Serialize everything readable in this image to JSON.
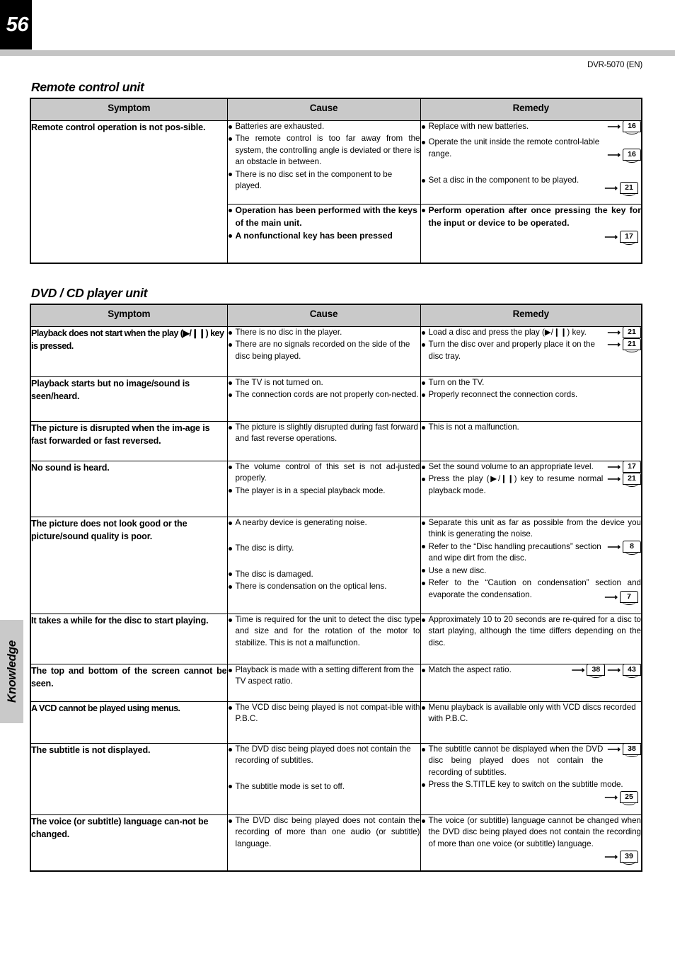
{
  "page": {
    "number": "56",
    "model_code": "DVR-5070 (EN)",
    "side_tab": "Knowledge"
  },
  "columns": [
    "Symptom",
    "Cause",
    "Remedy"
  ],
  "sections": [
    {
      "title": "Remote control unit",
      "rows": [
        {
          "symptom": "Remote control operation is not pos-sible.",
          "causes": [
            "Batteries are exhausted.",
            "The remote control is too far away from the system, the controlling angle is deviated or there is an obstacle in between.",
            "There is no disc set in the component to be played."
          ],
          "remedies": [
            "Replace with new batteries.",
            "Operate the unit inside the remote control-lable range.",
            "Set a disc in the component to be played."
          ],
          "refs": [
            "16",
            "16",
            "21"
          ]
        },
        {
          "symptom": "",
          "causes": [
            "Operation has been performed with the keys of the main unit.",
            "A nonfunctional key has been pressed"
          ],
          "remedies": [
            "Perform operation after once pressing the key for the input or device to be operated."
          ],
          "refs": [
            "17"
          ]
        }
      ]
    },
    {
      "title": "DVD / CD player unit",
      "rows": [
        {
          "symptom": "Playback does not start when the play (▶/❙❙) key is pressed.",
          "causes": [
            "There is no disc in the player.",
            "There are no signals recorded on the side of the disc being played."
          ],
          "remedies": [
            "Load a disc and press the play (▶/❙❙) key.",
            "Turn the disc over and properly place it on the disc tray."
          ],
          "refs": [
            "21",
            "21"
          ]
        },
        {
          "symptom": "Playback starts but no image/sound is seen/heard.",
          "causes": [
            "The TV is not turned on.",
            "The connection cords are not properly con-nected."
          ],
          "remedies": [
            "Turn on the TV.",
            "Properly reconnect the connection cords."
          ],
          "refs": []
        },
        {
          "symptom": "The picture is disrupted when the im-age is fast forwarded or fast reversed.",
          "causes": [
            "The picture is slightly disrupted during fast forward and fast reverse operations."
          ],
          "remedies": [
            "This is not a malfunction."
          ],
          "refs": []
        },
        {
          "symptom": "No sound is heard.",
          "causes": [
            "The volume control of this set is not ad-justed properly.",
            "The player is in a special playback mode."
          ],
          "remedies": [
            "Set the sound volume to an appropriate level.",
            "Press the play (▶/❙❙) key to resume normal playback mode."
          ],
          "refs": [
            "17",
            "21"
          ]
        },
        {
          "symptom": "The picture does not look good or the picture/sound quality is poor.",
          "causes": [
            "A nearby device is generating noise.",
            "The disc is dirty.",
            "The disc is damaged.",
            "There is condensation on the optical lens."
          ],
          "remedies": [
            "Separate this unit as far as possible from the device you think is generating the noise.",
            "Refer to the “Disc handling precautions” section and wipe dirt from the disc.",
            "Use a new disc.",
            "Refer to the “Caution on condensation” section and evaporate the condensation."
          ],
          "refs": [
            "8",
            "7"
          ]
        },
        {
          "symptom": "It takes a while for the disc to start playing.",
          "causes": [
            "Time is required for the unit to detect the disc type and size and for the rotation of the motor to stabilize. This is not a malfunction."
          ],
          "remedies": [
            "Approximately 10 to 20 seconds are re-quired for a disc to start playing, although the time differs depending on the disc."
          ],
          "refs": []
        },
        {
          "symptom": "The top and bottom of the screen cannot be seen.",
          "causes": [
            "Playback is made with a setting different from the TV aspect ratio."
          ],
          "remedies": [
            "Match the aspect ratio."
          ],
          "refs": [
            "38",
            "43"
          ]
        },
        {
          "symptom": "A VCD cannot be played using menus.",
          "causes": [
            "The VCD disc being played is not compat-ible with P.B.C."
          ],
          "remedies": [
            "Menu playback is available only with VCD discs recorded with P.B.C."
          ],
          "refs": []
        },
        {
          "symptom": "The subtitle is not displayed.",
          "causes": [
            "The DVD disc being played does not contain the recording of subtitles.",
            "The subtitle mode is set to off."
          ],
          "remedies": [
            "The subtitle cannot be displayed when the DVD disc being played does not contain the recording of subtitles.",
            "Press the S.TITLE key to switch on the subtitle mode."
          ],
          "refs": [
            "38",
            "25"
          ]
        },
        {
          "symptom": "The voice (or subtitle) language can-not be changed.",
          "causes": [
            "The DVD disc being played does not contain the recording of more than one audio (or subtitle) language."
          ],
          "remedies": [
            "The voice (or subtitle) language cannot be changed when the DVD disc being played does not contain the recording of more than one voice (or subtitle) language."
          ],
          "refs": [
            "39"
          ]
        }
      ]
    }
  ]
}
